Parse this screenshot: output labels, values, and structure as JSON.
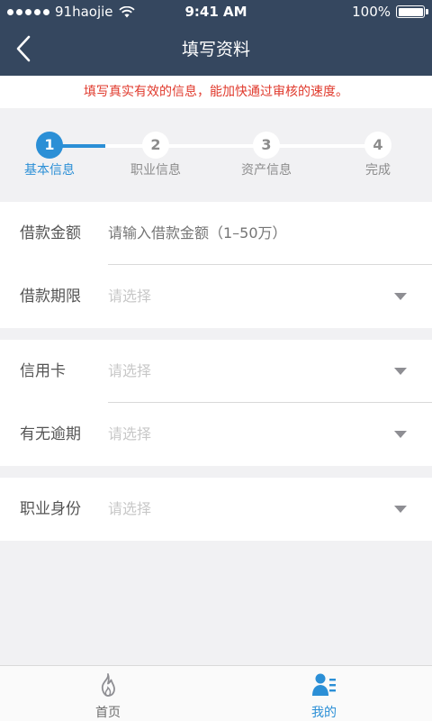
{
  "status_bar": {
    "carrier": "91haojie",
    "time": "9:41 AM",
    "battery": "100%"
  },
  "nav": {
    "title": "填写资料",
    "back_icon": "chevron-left-icon"
  },
  "notice": "填写真实有效的信息，能加快通过审核的速度。",
  "steps": [
    {
      "number": "1",
      "label": "基本信息",
      "active": true
    },
    {
      "number": "2",
      "label": "职业信息",
      "active": false
    },
    {
      "number": "3",
      "label": "资产信息",
      "active": false
    },
    {
      "number": "4",
      "label": "完成",
      "active": false
    }
  ],
  "fields": {
    "loan_amount": {
      "label": "借款金额",
      "placeholder": "请输入借款金额（1–50万）"
    },
    "loan_term": {
      "label": "借款期限",
      "value": "请选择"
    },
    "credit_card": {
      "label": "信用卡",
      "value": "请选择"
    },
    "overdue": {
      "label": "有无逾期",
      "value": "请选择"
    },
    "occupation": {
      "label": "职业身份",
      "value": "请选择"
    }
  },
  "tabs": [
    {
      "label": "首页",
      "icon": "flame-icon",
      "active": false
    },
    {
      "label": "我的",
      "icon": "user-list-icon",
      "active": true
    }
  ],
  "colors": {
    "nav_bg": "#35475f",
    "accent": "#2b8fd6",
    "notice": "#e03a2d"
  }
}
